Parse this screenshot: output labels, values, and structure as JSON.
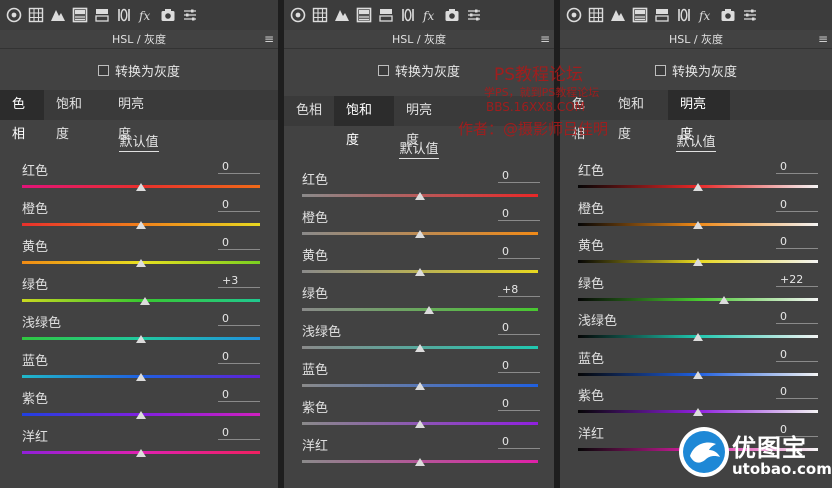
{
  "toolbar_icons": [
    "aperture-icon",
    "grid-icon",
    "mountain-icon",
    "hsl-panel-icon",
    "split-panel-icon",
    "lens-icon",
    "fx-icon",
    "camera-icon",
    "sliders-icon"
  ],
  "panels": [
    {
      "header": "HSL / 灰度",
      "convert_label": "转换为灰度",
      "tabs": [
        "色相",
        "饱和度",
        "明亮度"
      ],
      "active_tab": 0,
      "default_label": "默认值",
      "rows": [
        {
          "label": "红色",
          "value": "0",
          "level": 0
        },
        {
          "label": "橙色",
          "value": "0",
          "level": 0
        },
        {
          "label": "黄色",
          "value": "0",
          "level": 0
        },
        {
          "label": "绿色",
          "value": "+3",
          "level": 3
        },
        {
          "label": "浅绿色",
          "value": "0",
          "level": 0
        },
        {
          "label": "蓝色",
          "value": "0",
          "level": 0
        },
        {
          "label": "紫色",
          "value": "0",
          "level": 0
        },
        {
          "label": "洋红",
          "value": "0",
          "level": 0
        }
      ]
    },
    {
      "header": "HSL / 灰度",
      "convert_label": "转换为灰度",
      "tabs": [
        "色相",
        "饱和度",
        "明亮度"
      ],
      "active_tab": 1,
      "default_label": "默认值",
      "rows": [
        {
          "label": "红色",
          "value": "0",
          "level": 0
        },
        {
          "label": "橙色",
          "value": "0",
          "level": 0
        },
        {
          "label": "黄色",
          "value": "0",
          "level": 0
        },
        {
          "label": "绿色",
          "value": "+8",
          "level": 8
        },
        {
          "label": "浅绿色",
          "value": "0",
          "level": 0
        },
        {
          "label": "蓝色",
          "value": "0",
          "level": 0
        },
        {
          "label": "紫色",
          "value": "0",
          "level": 0
        },
        {
          "label": "洋红",
          "value": "0",
          "level": 0
        }
      ]
    },
    {
      "header": "HSL / 灰度",
      "convert_label": "转换为灰度",
      "tabs": [
        "色相",
        "饱和度",
        "明亮度"
      ],
      "active_tab": 2,
      "default_label": "默认值",
      "rows": [
        {
          "label": "红色",
          "value": "0",
          "level": 0
        },
        {
          "label": "橙色",
          "value": "0",
          "level": 0
        },
        {
          "label": "黄色",
          "value": "0",
          "level": 0
        },
        {
          "label": "绿色",
          "value": "+22",
          "level": 22
        },
        {
          "label": "浅绿色",
          "value": "0",
          "level": 0
        },
        {
          "label": "蓝色",
          "value": "0",
          "level": 0
        },
        {
          "label": "紫色",
          "value": "0",
          "level": 0
        },
        {
          "label": "洋红",
          "value": "0",
          "level": 0
        }
      ]
    }
  ],
  "watermark": {
    "line1": "PS教程论坛",
    "line2": "学PS，就到PS教程论坛",
    "line3": "BBS.16XX8.COM",
    "line4": "作者：@摄影师吕佳明"
  },
  "logo": {
    "name": "优图宝",
    "url": "utobao.com"
  },
  "colors": {
    "panel_bg": "#424242",
    "active_tab_bg": "#2c2c2c",
    "watermark": "#b01818",
    "logo_blue": "#1e88d6"
  }
}
